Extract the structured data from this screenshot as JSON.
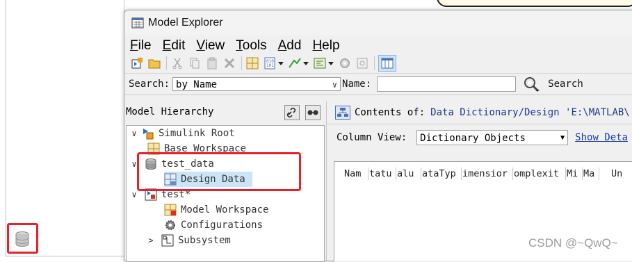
{
  "window": {
    "title": "Model Explorer"
  },
  "menu": {
    "items": [
      {
        "key": "F",
        "rest": "ile"
      },
      {
        "key": "E",
        "rest": "dit"
      },
      {
        "key": "V",
        "rest": "iew"
      },
      {
        "key": "T",
        "rest": "ools"
      },
      {
        "key": "A",
        "rest": "dd"
      },
      {
        "key": "H",
        "rest": "elp"
      }
    ]
  },
  "searchbar": {
    "label": "Search:",
    "mode": "by Name",
    "name_label": "Name:",
    "name_value": "",
    "search_label": "Search"
  },
  "hierarchy": {
    "title": "Model Hierarchy",
    "nodes": [
      {
        "label": "Simulink Root",
        "twisty": "∨",
        "icon": "simulink-root-icon"
      },
      {
        "label": "Base Workspace",
        "twisty": "",
        "icon": "workspace-grid-icon"
      },
      {
        "label": "test_data",
        "twisty": "∨",
        "icon": "database-icon"
      },
      {
        "label": "Design Data",
        "twisty": "",
        "icon": "design-data-icon"
      },
      {
        "label": "test*",
        "twisty": "∨",
        "icon": "model-icon"
      },
      {
        "label": "Model Workspace",
        "twisty": "",
        "icon": "model-workspace-icon"
      },
      {
        "label": "Configurations",
        "twisty": "",
        "icon": "gear-icon"
      },
      {
        "label": "Subsystem",
        "twisty": ">",
        "icon": "subsystem-icon"
      }
    ]
  },
  "contents": {
    "prefix": "Contents of:",
    "path": "Data Dictionary/Design 'E:\\MATLAB\\"
  },
  "column_view": {
    "label": "Column View:",
    "value": "Dictionary Objects",
    "link": "Show Deta"
  },
  "grid": {
    "headers": [
      "Nam",
      "tatu",
      "alu",
      "ataTyp",
      "imensior",
      "omplexit",
      "Mi",
      "Ma",
      "Un"
    ]
  },
  "watermark": "CSDN @~QwQ~",
  "colors": {
    "highlight_red": "#e8202a",
    "selection_blue": "#cce4f7",
    "link_blue": "#1a3ab0"
  }
}
